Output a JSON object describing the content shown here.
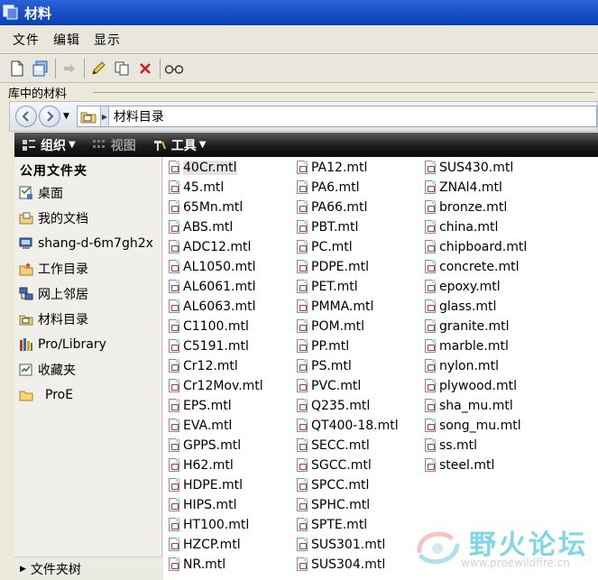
{
  "window": {
    "title": "材料"
  },
  "menu": {
    "items": [
      "文件",
      "编辑",
      "显示"
    ]
  },
  "toolbar": {
    "buttons": [
      "new-file-icon",
      "save-icon",
      "arrow-right-icon",
      "pencil-icon",
      "copy-icon",
      "delete-icon",
      "glasses-icon"
    ]
  },
  "library_frame": {
    "label": "库中的材料"
  },
  "address": {
    "path": "材料目录"
  },
  "commands": {
    "organize": "组织",
    "view": "视图",
    "tools": "工具"
  },
  "sidebar": {
    "header": "公用文件夹",
    "items": [
      {
        "label": "桌面",
        "icon": "desktop-icon"
      },
      {
        "label": "我的文档",
        "icon": "documents-icon"
      },
      {
        "label": "shang-d-6m7gh2x",
        "icon": "computer-icon"
      },
      {
        "label": "工作目录",
        "icon": "working-directory-icon"
      },
      {
        "label": "网上邻居",
        "icon": "network-icon"
      },
      {
        "label": "材料目录",
        "icon": "materials-folder-icon"
      },
      {
        "label": "Pro/Library",
        "icon": "library-icon"
      },
      {
        "label": "收藏夹",
        "icon": "favorites-icon"
      },
      {
        "label": "ProE",
        "icon": "folder-icon"
      }
    ],
    "folder_tree": "文件夹树"
  },
  "files": {
    "col1": [
      "40Cr.mtl",
      "45.mtl",
      "65Mn.mtl",
      "ABS.mtl",
      "ADC12.mtl",
      "AL1050.mtl",
      "AL6061.mtl",
      "AL6063.mtl",
      "C1100.mtl",
      "C5191.mtl",
      "Cr12.mtl",
      "Cr12Mov.mtl",
      "EPS.mtl",
      "EVA.mtl",
      "GPPS.mtl",
      "H62.mtl",
      "HDPE.mtl",
      "HIPS.mtl",
      "HT100.mtl",
      "HZCP.mtl",
      "NR.mtl"
    ],
    "col2": [
      "PA12.mtl",
      "PA6.mtl",
      "PA66.mtl",
      "PBT.mtl",
      "PC.mtl",
      "PDPE.mtl",
      "PET.mtl",
      "PMMA.mtl",
      "POM.mtl",
      "PP.mtl",
      "PS.mtl",
      "PVC.mtl",
      "Q235.mtl",
      "QT400-18.mtl",
      "SECC.mtl",
      "SGCC.mtl",
      "SPCC.mtl",
      "SPHC.mtl",
      "SPTE.mtl",
      "SUS301.mtl",
      "SUS304.mtl"
    ],
    "col3": [
      "SUS430.mtl",
      "ZNAl4.mtl",
      "bronze.mtl",
      "china.mtl",
      "chipboard.mtl",
      "concrete.mtl",
      "epoxy.mtl",
      "glass.mtl",
      "granite.mtl",
      "marble.mtl",
      "nylon.mtl",
      "plywood.mtl",
      "sha_mu.mtl",
      "song_mu.mtl",
      "ss.mtl",
      "steel.mtl"
    ],
    "selected": "40Cr.mtl"
  },
  "watermark": {
    "title": "野火论坛",
    "url": "www.proewildfire.cn"
  }
}
